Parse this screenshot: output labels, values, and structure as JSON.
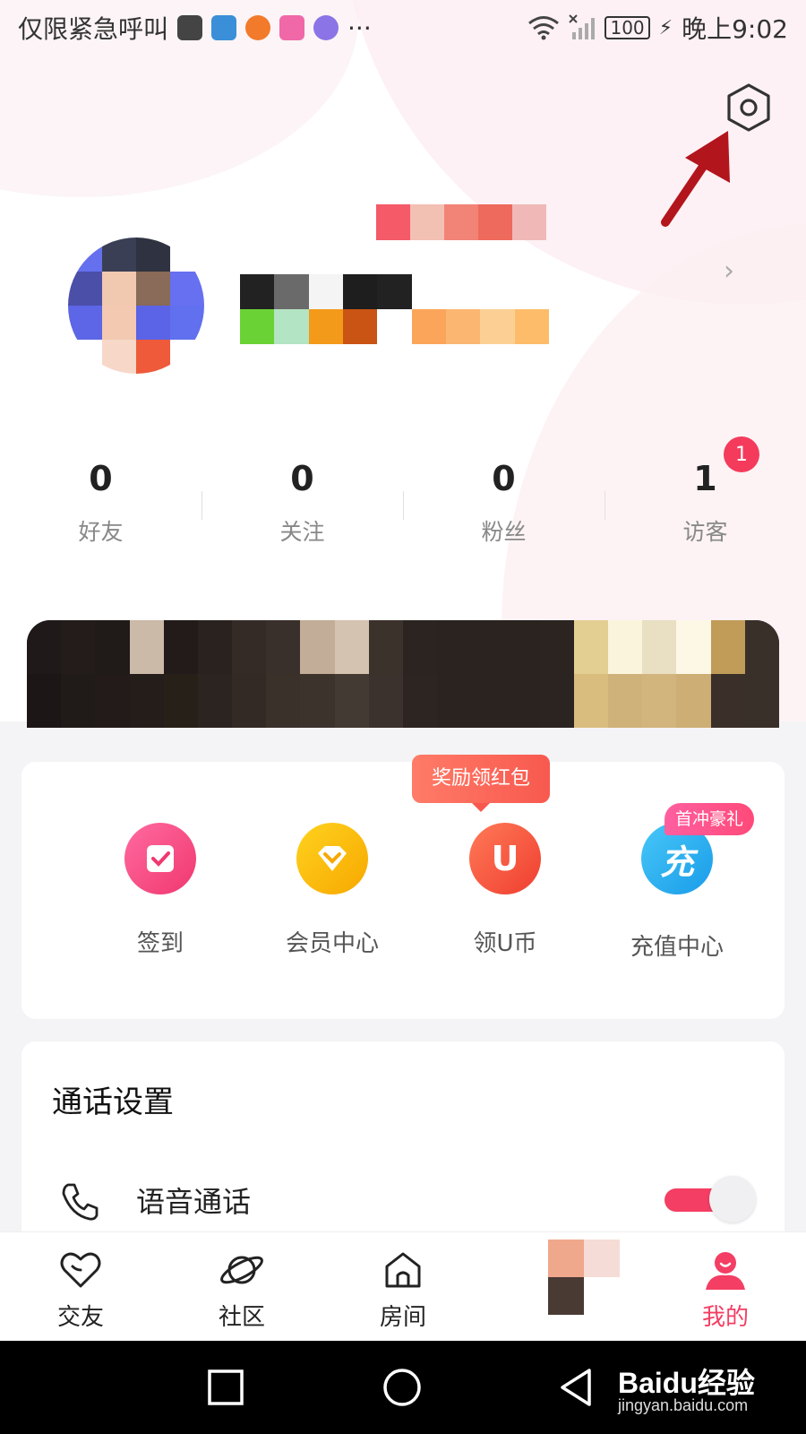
{
  "status_bar": {
    "carrier_text": "仅限紧急呼叫",
    "more": "···",
    "battery": "100",
    "time": "晚上9:02"
  },
  "stats": [
    {
      "value": "0",
      "label": "好友"
    },
    {
      "value": "0",
      "label": "关注"
    },
    {
      "value": "0",
      "label": "粉丝"
    },
    {
      "value": "1",
      "label": "访客"
    }
  ],
  "visitor_badge": "1",
  "quick_actions": [
    {
      "label": "签到",
      "icon": "checkin-icon",
      "color": "#f5467f"
    },
    {
      "label": "会员中心",
      "icon": "vip-diamond-icon",
      "color": "#fdb600"
    },
    {
      "label": "领U币",
      "icon_text": "U",
      "icon": "ucoin-icon",
      "color": "#f75642"
    },
    {
      "label": "充值中心",
      "icon_text": "充",
      "icon": "recharge-icon",
      "color": "#2ab0f2"
    }
  ],
  "reward_bubble": "奖励领红包",
  "first_recharge_tag": "首冲豪礼",
  "call_settings": {
    "title": "通话设置",
    "voice_call_label": "语音通话",
    "voice_call_enabled": true
  },
  "tabs": [
    {
      "label": "交友",
      "icon": "heart-icon"
    },
    {
      "label": "社区",
      "icon": "planet-icon"
    },
    {
      "label": "房间",
      "icon": "house-icon"
    },
    {
      "label": "",
      "icon": "pixelated-tab-icon"
    },
    {
      "label": "我的",
      "icon": "profile-icon",
      "active": true
    }
  ],
  "watermark": {
    "brand": "Baidu经验",
    "url": "jingyan.baidu.com"
  },
  "colors": {
    "accent": "#f43e63",
    "annotation_arrow": "#b3151d"
  }
}
